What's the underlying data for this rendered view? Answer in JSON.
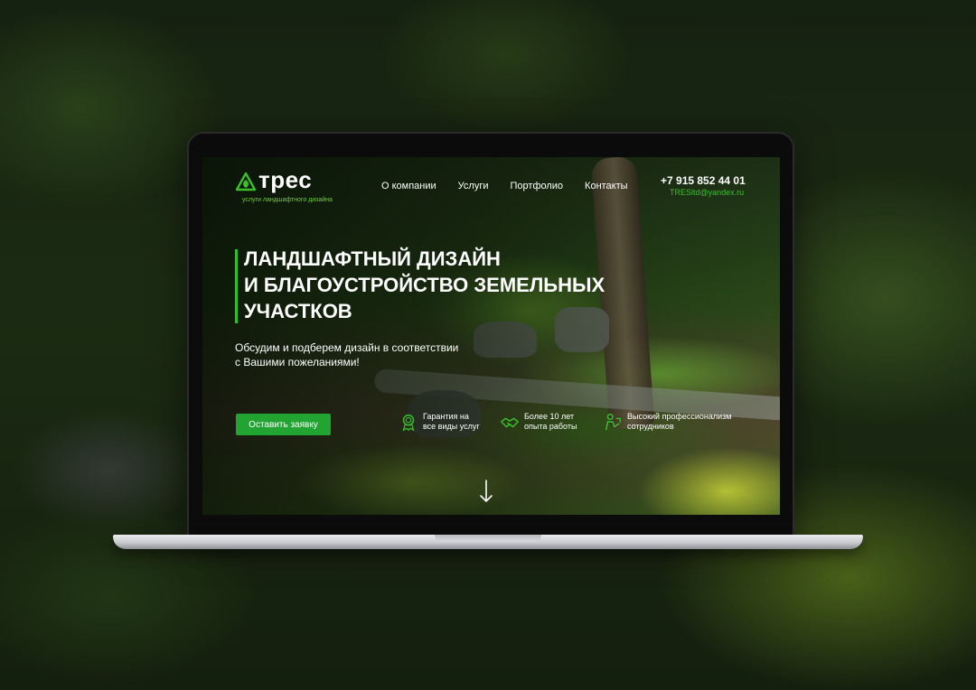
{
  "brand": {
    "name": "трес",
    "tagline": "услуги ландшафтного дизайна"
  },
  "nav": {
    "items": [
      {
        "label": "О компании"
      },
      {
        "label": "Услуги"
      },
      {
        "label": "Портфолио"
      },
      {
        "label": "Контакты"
      }
    ]
  },
  "contacts": {
    "phone": "+7 915 852 44 01",
    "email": "TRESltd@yandex.ru"
  },
  "hero": {
    "title_lines": [
      "ЛАНДШАФТНЫЙ ДИЗАЙН",
      "И БЛАГОУСТРОЙСТВО ЗЕМЕЛЬНЫХ",
      "УЧАСТКОВ"
    ],
    "subtitle_lines": [
      "Обсудим и подберем дизайн в соответствии",
      "с Вашими пожеланиями!"
    ],
    "cta_label": "Оставить заявку"
  },
  "features": [
    {
      "icon": "medal-icon",
      "lines": [
        "Гарантия на",
        "все виды услуг"
      ]
    },
    {
      "icon": "handshake-icon",
      "lines": [
        "Более 10 лет",
        "опыта работы"
      ]
    },
    {
      "icon": "worker-icon",
      "lines": [
        "Высокий профессионализм",
        "сотрудников"
      ]
    }
  ],
  "colors": {
    "accent": "#21a431",
    "email": "#36c22a",
    "text": "#ffffff"
  }
}
